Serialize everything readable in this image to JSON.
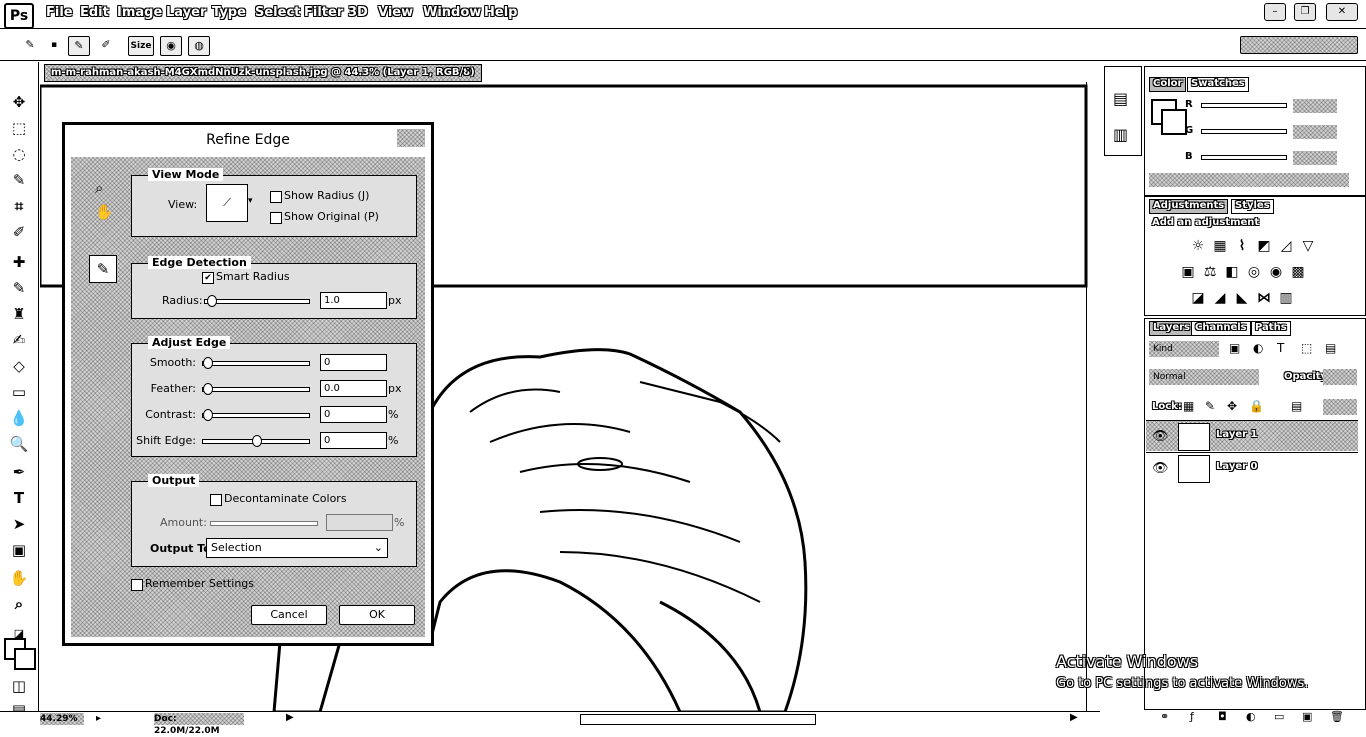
{
  "app": {
    "logo": "Ps",
    "menu": [
      "File",
      "Edit",
      "Image",
      "Layer",
      "Type",
      "Select",
      "Filter",
      "3D",
      "View",
      "Window",
      "Help"
    ],
    "window_controls": [
      "–",
      "❐",
      "✕"
    ]
  },
  "options_bar": {
    "size_label": "Size"
  },
  "document": {
    "tab_title": "m-m-rahman-akash-M4GXmdNnUzk-unsplash.jpg @ 44.3% (Layer 1, RGB/8) *",
    "tab_close": "✕"
  },
  "status": {
    "zoom": "44.29%",
    "doc_size": "Doc: 22.0M/22.0M"
  },
  "dialog": {
    "title": "Refine Edge",
    "view_mode": {
      "heading": "View Mode",
      "view_label": "View:",
      "show_radius": "Show Radius (J)",
      "show_original": "Show Original (P)"
    },
    "edge_detection": {
      "heading": "Edge Detection",
      "smart_radius": "Smart Radius",
      "smart_radius_checked": true,
      "radius_label": "Radius:",
      "radius_value": "1.0",
      "radius_unit": "px",
      "radius_level": 0.02
    },
    "adjust_edge": {
      "heading": "Adjust Edge",
      "rows": [
        {
          "label": "Smooth:",
          "value": "0",
          "unit": "",
          "level": 0.0
        },
        {
          "label": "Feather:",
          "value": "0.0",
          "unit": "px",
          "level": 0.0
        },
        {
          "label": "Contrast:",
          "value": "0",
          "unit": "%",
          "level": 0.0
        },
        {
          "label": "Shift Edge:",
          "value": "0",
          "unit": "%",
          "level": 0.5
        }
      ]
    },
    "output": {
      "heading": "Output",
      "decontaminate": "Decontaminate Colors",
      "amount_label": "Amount:",
      "amount_unit": "%",
      "output_to_label": "Output To:",
      "output_to_value": "Selection"
    },
    "remember": "Remember Settings",
    "cancel": "Cancel",
    "ok": "OK"
  },
  "panels": {
    "color_tabs": [
      "Color",
      "Swatches"
    ],
    "color_channels": [
      "R",
      "G",
      "B"
    ],
    "adjust_tabs": [
      "Adjustments",
      "Styles"
    ],
    "add_adjustment": "Add an adjustment",
    "layers_tabs": [
      "Layers",
      "Channels",
      "Paths"
    ],
    "kind": "Kind",
    "blend_mode": "Normal",
    "opacity_label": "Opacity:",
    "lock_label": "Lock:",
    "layers": [
      {
        "name": "Layer 1"
      },
      {
        "name": "Layer 0"
      }
    ]
  },
  "watermark": {
    "line1": "Activate Windows",
    "line2": "Go to PC settings to activate Windows."
  }
}
